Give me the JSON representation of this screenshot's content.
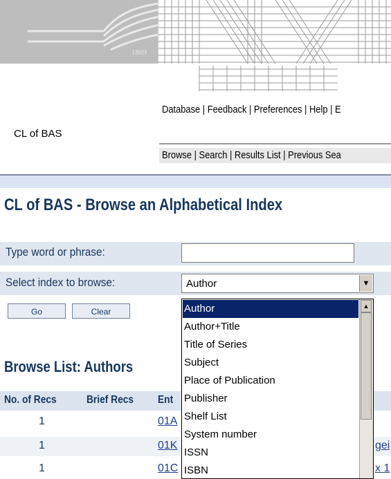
{
  "header": {
    "logo_year": "1869",
    "nav_top": "Database | Feedback | Preferences | Help | E",
    "nav_bottom": "Browse | Search | Results List | Previous Sea",
    "site_label": "CL of BAS"
  },
  "page_title": "CL of BAS - Browse an Alphabetical Index",
  "form": {
    "word_label": "Type word or phrase:",
    "word_value": "",
    "index_label": "Select index to browse:",
    "index_value": "Author",
    "go_label": "Go",
    "clear_label": "Clear"
  },
  "dropdown": {
    "options": [
      "Author",
      "Author+Title",
      "Title of Series",
      "Subject",
      "Place of Publication",
      "Publisher",
      "Shelf List",
      "System number",
      "ISSN",
      "ISBN"
    ],
    "selected": "Author"
  },
  "browse": {
    "title": "Browse List: Authors",
    "columns": [
      "No. of Recs",
      "Brief Recs",
      "Ent"
    ],
    "rows": [
      {
        "recs": "1",
        "entry": "01A"
      },
      {
        "recs": "1",
        "entry": "01K",
        "tail": "gei"
      },
      {
        "recs": "1",
        "entry": "01C",
        "tail": "x 1"
      }
    ]
  }
}
